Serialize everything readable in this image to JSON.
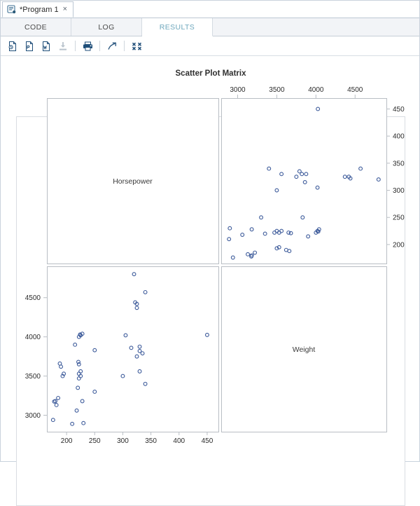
{
  "window": {
    "document_tab": {
      "title": "*Program 1",
      "close_label": "×",
      "icon": "program-icon"
    }
  },
  "view_tabs": [
    {
      "label": "CODE",
      "active": false
    },
    {
      "label": "LOG",
      "active": false
    },
    {
      "label": "RESULTS",
      "active": true
    }
  ],
  "toolbar": {
    "buttons": [
      {
        "name": "export-html-icon",
        "label": "HTML",
        "enabled": true
      },
      {
        "name": "export-pdf-icon",
        "label": "PDF",
        "enabled": true
      },
      {
        "name": "export-word-icon",
        "label": "Word",
        "enabled": true
      },
      {
        "name": "download-icon",
        "label": "Download",
        "enabled": false
      },
      {
        "name": "print-icon",
        "label": "Print",
        "enabled": true
      },
      {
        "name": "open-in-new-window-icon",
        "label": "Open in new window",
        "enabled": true
      },
      {
        "name": "collapse-all-icon",
        "label": "Collapse",
        "enabled": true
      }
    ]
  },
  "colors": {
    "accent": "#6fa8bd",
    "marker": "#3c5a9a",
    "axis": "#b9bec4",
    "panel_border": "#d9dde2",
    "toolbar_icon": "#1f4e79",
    "toolbar_icon_disabled": "#b9c3cc"
  },
  "chart_data": {
    "type": "scatter",
    "title": "Scatter Plot Matrix",
    "variables": [
      "Horsepower",
      "Weight"
    ],
    "layout": "2x2 scatter plot matrix, diagonal cells show variable names",
    "grid": false,
    "legend": false,
    "axes": {
      "horsepower": {
        "label": "Horsepower",
        "ticks": [
          200,
          250,
          300,
          350,
          400,
          450
        ],
        "range": [
          165,
          470
        ],
        "bottom_axis_position": "bottom-left cell x-axis",
        "right_axis_position": "top-right cell y-axis",
        "right_ticks": [
          200,
          250,
          300,
          350,
          400,
          450
        ]
      },
      "weight": {
        "label": "Weight",
        "ticks": [
          3000,
          3500,
          4000,
          4500
        ],
        "range": [
          2790,
          4900
        ],
        "top_axis_position": "top-right cell x-axis",
        "left_axis_position": "bottom-left cell y-axis",
        "left_ticks": [
          3000,
          3500,
          4000,
          4500
        ]
      }
    },
    "points": [
      {
        "horsepower": 450,
        "weight": 4025
      },
      {
        "horsepower": 340,
        "weight": 3400
      },
      {
        "horsepower": 335,
        "weight": 3790
      },
      {
        "horsepower": 330,
        "weight": 3820
      },
      {
        "horsepower": 330,
        "weight": 3875
      },
      {
        "horsepower": 325,
        "weight": 3750
      },
      {
        "horsepower": 330,
        "weight": 3560
      },
      {
        "horsepower": 325,
        "weight": 4370
      },
      {
        "horsepower": 325,
        "weight": 4420
      },
      {
        "horsepower": 322,
        "weight": 4440
      },
      {
        "horsepower": 320,
        "weight": 4800
      },
      {
        "horsepower": 315,
        "weight": 3860
      },
      {
        "horsepower": 305,
        "weight": 4020
      },
      {
        "horsepower": 250,
        "weight": 3300
      },
      {
        "horsepower": 250,
        "weight": 3830
      },
      {
        "horsepower": 230,
        "weight": 2900
      },
      {
        "horsepower": 228,
        "weight": 3180
      },
      {
        "horsepower": 225,
        "weight": 3500
      },
      {
        "horsepower": 225,
        "weight": 3560
      },
      {
        "horsepower": 222,
        "weight": 3470
      },
      {
        "horsepower": 222,
        "weight": 3530
      },
      {
        "horsepower": 222,
        "weight": 4000
      },
      {
        "horsepower": 224,
        "weight": 4030
      },
      {
        "horsepower": 228,
        "weight": 4040
      },
      {
        "horsepower": 225,
        "weight": 4020
      },
      {
        "horsepower": 222,
        "weight": 3650
      },
      {
        "horsepower": 221,
        "weight": 3680
      },
      {
        "horsepower": 220,
        "weight": 3350
      },
      {
        "horsepower": 218,
        "weight": 3060
      },
      {
        "horsepower": 215,
        "weight": 3900
      },
      {
        "horsepower": 210,
        "weight": 2890
      },
      {
        "horsepower": 195,
        "weight": 3530
      },
      {
        "horsepower": 193,
        "weight": 3500
      },
      {
        "horsepower": 190,
        "weight": 3620
      },
      {
        "horsepower": 188,
        "weight": 3660
      },
      {
        "horsepower": 185,
        "weight": 3220
      },
      {
        "horsepower": 182,
        "weight": 3130
      },
      {
        "horsepower": 180,
        "weight": 3180
      },
      {
        "horsepower": 178,
        "weight": 3175
      },
      {
        "horsepower": 176,
        "weight": 2940
      },
      {
        "horsepower": 300,
        "weight": 3500
      },
      {
        "horsepower": 340,
        "weight": 4570
      }
    ]
  }
}
